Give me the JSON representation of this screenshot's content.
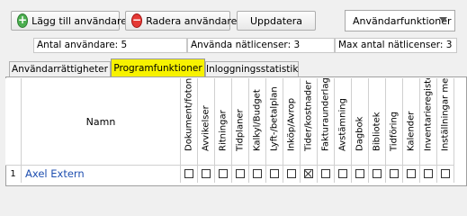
{
  "toolbar": {
    "add_label": "Lägg till användare",
    "remove_label": "Radera användare",
    "update_label": "Uppdatera",
    "dropdown_label": "Användarfunktioner"
  },
  "stats": {
    "users": "Antal användare: 5",
    "used_licenses": "Använda nätlicenser: 3",
    "max_licenses": "Max antal nätlicenser: 3"
  },
  "tabs": [
    {
      "label": "Användarrättigheter"
    },
    {
      "label": "Programfunktioner"
    },
    {
      "label": "Inloggningsstatistik"
    }
  ],
  "table": {
    "name_header": "Namn",
    "columns": [
      "Dokument/foton",
      "Avvikelser",
      "Ritningar",
      "Tidplaner",
      "Kalkyl/Budget",
      "Lyft-/betalplan",
      "Inköp/Avrop",
      "Tider/kostnader",
      "Fakturaunderlag",
      "Avstämning",
      "Dagbok",
      "Bibliotek",
      "Tidföring",
      "Kalender",
      "Inventarieregister",
      "Inställningar meny"
    ],
    "rows": [
      {
        "num": "1",
        "name": "Axel Extern",
        "checks": [
          false,
          false,
          false,
          false,
          false,
          false,
          false,
          true,
          false,
          false,
          false,
          false,
          false,
          false,
          false,
          false
        ]
      }
    ]
  },
  "colors": {
    "active_tab": "#f7f200",
    "name_link": "#1f4fb0"
  },
  "icons": {
    "add": "plus-circle-icon",
    "remove": "minus-circle-icon",
    "dropdown": "chevron-down-icon"
  }
}
